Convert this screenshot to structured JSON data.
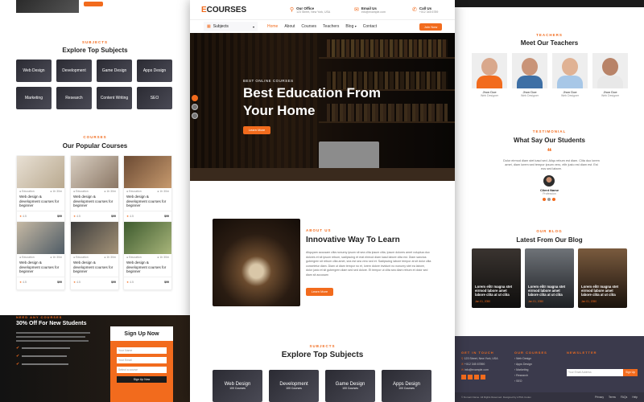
{
  "left": {
    "subjects": {
      "label": "SUBJECTS",
      "title": "Explore Top Subjects",
      "items": [
        "Web Design",
        "Development",
        "Game Design",
        "Apps Design",
        "Marketing",
        "Research",
        "Content Writing",
        "SEO"
      ]
    },
    "courses": {
      "label": "COURSES",
      "title": "Our Popular Courses",
      "items": [
        {
          "title": "Web design & development courses for beginner",
          "rating": "4.5",
          "price": "$99"
        },
        {
          "title": "Web design & development courses for beginner",
          "rating": "4.5",
          "price": "$99"
        },
        {
          "title": "Web design & development courses for beginner",
          "rating": "4.5",
          "price": "$99"
        },
        {
          "title": "Web design & development courses for beginner",
          "rating": "4.5",
          "price": "$99"
        },
        {
          "title": "Web design & development courses for beginner",
          "rating": "4.5",
          "price": "$99"
        },
        {
          "title": "Web design & development courses for beginner",
          "rating": "4.5",
          "price": "$99"
        }
      ]
    },
    "offer": {
      "label": "NEED ANY COURSES",
      "title": "30% Off For New Students"
    },
    "signup": {
      "title": "Sign Up Now",
      "name_ph": "Your Name",
      "email_ph": "Your Email",
      "select": "Select a course",
      "button": "Sign Up Now"
    }
  },
  "center": {
    "logo_prefix": "E",
    "logo_rest": "COURSES",
    "contacts": [
      {
        "title": "Our Office",
        "sub": "123 Street, New York, USA",
        "icon": "location-icon"
      },
      {
        "title": "Email Us",
        "sub": "info@example.com",
        "icon": "envelope-icon"
      },
      {
        "title": "Call Us",
        "sub": "+012 345 6789",
        "icon": "phone-icon"
      }
    ],
    "subjects_select": "Subjects",
    "nav": [
      "Home",
      "About",
      "Courses",
      "Teachers",
      "Blog",
      "Contact"
    ],
    "join_button": "Join Now",
    "hero": {
      "eyebrow": "BEST ONLINE COURSES",
      "title_line1": "Best Education From",
      "title_line2": "Your Home",
      "button": "Learn More"
    },
    "about": {
      "label": "ABOUT US",
      "title": "Innovative Way To Learn",
      "body": "Aliquyam accusam clita nonumy ipsum sit sea clita ipsum clita, ipsum dolores amet voluptua duo dolores et sit ipsum rebum, sadipscing et erat eirmod diam kasd labore clita est. Diam sanctus gubergren sit rebum clita amet, sea est sea vero sed et. Sadipscing labore tempor at sit dolor clita consetetur diam. Diam ut diam tempor no et, lorem dolore invidunt no nonumy stet ea labore, dolor justo et sit gubergren diam sed sed dolore. Et tempor ut clita sea diam rebum et dolor sed diam sit accusam",
      "button": "Learn More"
    },
    "subjects": {
      "label": "SUBJECTS",
      "title": "Explore Top Subjects",
      "items": [
        {
          "name": "Web Design",
          "count": "100 Courses"
        },
        {
          "name": "Development",
          "count": "100 Courses"
        },
        {
          "name": "Game Design",
          "count": "100 Courses"
        },
        {
          "name": "Apps Design",
          "count": "100 Courses"
        }
      ]
    }
  },
  "right": {
    "teachers": {
      "label": "TEACHERS",
      "title": "Meet Our Teachers",
      "items": [
        {
          "name": "Jhon Doe",
          "role": "Web Designer"
        },
        {
          "name": "Jhon Doe",
          "role": "Web Designer"
        },
        {
          "name": "Jhon Doe",
          "role": "Web Designer"
        },
        {
          "name": "Jhon Doe",
          "role": "Web Designer"
        }
      ]
    },
    "testimonial": {
      "label": "TESTIMONIAL",
      "title": "What Say Our Students",
      "quote_mark": "❝",
      "text": "Dolor eirmod diam stet kasd sed. Aliqu rebum est diam. Clita duo lorem amet, diam lorem sed tempor ipsum vero, elitr justo est diam est. Est eos sed labore.",
      "name": "Client Name",
      "role": "Profession"
    },
    "blog": {
      "label": "OUR BLOG",
      "title": "Latest From Our Blog",
      "items": [
        {
          "title": "Lorem elitr magna stet eirmod labore amet labore clita at ut clita",
          "date": "Jan 01, 2050"
        },
        {
          "title": "Lorem elitr magna stet eirmod labore amet labore clita at ut clita",
          "date": "Jan 01, 2050"
        },
        {
          "title": "Lorem elitr magna stet eirmod labore amet labore clita at ut clita",
          "date": "Jan 01, 2050"
        }
      ]
    },
    "footer": {
      "get_in_touch": "GET IN TOUCH",
      "address": "123 Street, New York, USA",
      "phone": "+012 345 67890",
      "email": "info@example.com",
      "courses_label": "OUR COURSES",
      "courses": [
        "Web Design",
        "Apps Design",
        "Marketing",
        "Research",
        "SEO"
      ],
      "newsletter_label": "NEWSLETTER",
      "newsletter_ph": "Your Email Address",
      "newsletter_btn": "Sign Up",
      "copyright": "© Domain Name. All Rights Reserved. Designed by HTML Codex",
      "links": [
        "Privacy",
        "Terms",
        "FAQs",
        "Help"
      ]
    }
  },
  "colors": {
    "accent": "#f26b1d",
    "dark": "#1b1b1b",
    "footer": "#3b3a4c"
  }
}
